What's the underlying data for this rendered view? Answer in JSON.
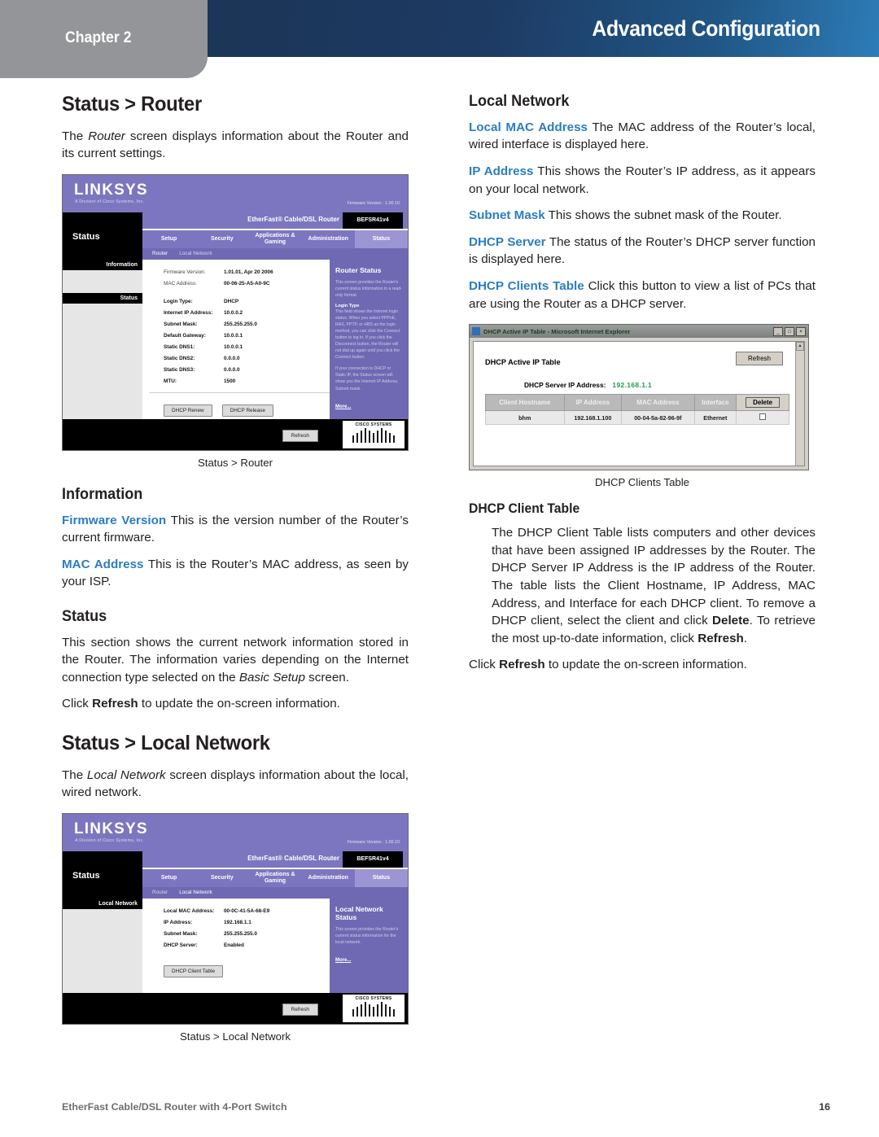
{
  "header": {
    "chapter": "Chapter 2",
    "title": "Advanced Configuration",
    "band_color": "#1c3557",
    "tab_color": "#939598"
  },
  "left_column": {
    "heading_status_router": "Status > Router",
    "intro_1": "The ",
    "intro_italic": "Router",
    "intro_2": " screen displays information about the Router and its current settings.",
    "caption_router": "Status > Router",
    "heading_information": "Information",
    "firmware_term": "Firmware Version",
    "firmware_text": " This is the version number of the Router’s current firmware.",
    "mac_term": "MAC Address",
    "mac_text": " This is the Router’s MAC address, as seen by your ISP.",
    "heading_status": "Status",
    "status_text_1": "This section shows the current network information stored in the Router. The information varies depending on the Internet connection type selected on the ",
    "status_italic": "Basic Setup",
    "status_text_2": " screen.",
    "refresh_pre": "Click ",
    "refresh_bold": "Refresh",
    "refresh_post": " to update the on-screen information.",
    "heading_status_local": "Status > Local Network",
    "local_intro_1": "The ",
    "local_intro_italic": "Local Network",
    "local_intro_2": " screen displays information about the local, wired network.",
    "caption_local": "Status > Local Network"
  },
  "right_column": {
    "heading_local_network": "Local Network",
    "local_mac_term": "Local MAC Address",
    "local_mac_text": " The MAC address of the Router’s local, wired interface is displayed here.",
    "ip_term": "IP Address",
    "ip_text": " This shows the Router’s IP address, as it appears on your local network.",
    "subnet_term": "Subnet Mask",
    "subnet_text": "  This shows the subnet mask of the Router.",
    "dhcp_server_term": "DHCP Server",
    "dhcp_server_text": " The status of the Router’s DHCP server function is displayed here.",
    "dhcp_clients_term": "DHCP Clients Table",
    "dhcp_clients_text": "  Click this button to view a list of PCs that are using the Router as a DHCP server.",
    "caption_dhcp": "DHCP Clients Table",
    "heading_dhcp_client_table": "DHCP Client Table",
    "dhcp_body_1": "The DHCP Client Table lists computers and other devices that have been assigned IP addresses by the Router. The DHCP Server IP Address is the IP address of the Router. The table lists the Client Hostname, IP Address, MAC Address, and Interface for each DHCP client. To remove a DHCP client, select the client and click ",
    "dhcp_body_delete": "Delete",
    "dhcp_body_2": ". To retrieve the most up-to-date information, click ",
    "dhcp_body_refresh": "Refresh",
    "dhcp_body_3": ".",
    "refresh_pre": "Click ",
    "refresh_bold": "Refresh",
    "refresh_post": " to update the on-screen information."
  },
  "router_screenshot": {
    "brand": "LINKSYS",
    "brand_sub": "A Division of Cisco Systems, Inc.",
    "firmware_version_label": "Firmware Version : 1.00.10",
    "section_word": "Status",
    "product_name": "EtherFast® Cable/DSL Router",
    "model": "BEFSR41v4",
    "tabs": [
      "Setup",
      "Security",
      "Applications & Gaming",
      "Administration",
      "Status"
    ],
    "active_tab": "Status",
    "subtabs": [
      "Router",
      "Local Network"
    ],
    "active_subtab": "Router",
    "sidebar_headings": [
      "Information",
      "Status"
    ],
    "fields": [
      {
        "label": "Firmware Version:",
        "value": "1.01.01, Apr 20 2006",
        "bold": false
      },
      {
        "label": "MAC Address:",
        "value": "00-06-25-A5-A0-9C",
        "bold": false
      },
      {
        "label": "Login Type:",
        "value": "DHCP",
        "bold": true
      },
      {
        "label": "Internet IP Address:",
        "value": "10.0.0.2",
        "bold": true
      },
      {
        "label": "Subnet Mask:",
        "value": "255.255.255.0",
        "bold": true
      },
      {
        "label": "Default Gateway:",
        "value": "10.0.0.1",
        "bold": true
      },
      {
        "label": "Static DNS1:",
        "value": "10.0.0.1",
        "bold": true
      },
      {
        "label": "Static DNS2:",
        "value": "0.0.0.0",
        "bold": true
      },
      {
        "label": "Static DNS3:",
        "value": "0.0.0.0",
        "bold": true
      },
      {
        "label": "MTU:",
        "value": "1500",
        "bold": true
      }
    ],
    "buttons": [
      "DHCP Renew",
      "DHCP Release"
    ],
    "refresh_button": "Refresh",
    "help_title": "Router Status",
    "help_p1": "This screen provides the Router's current status information in a read-only format.",
    "help_h2": "Login Type",
    "help_p2": "This field shows the Internet login status. When you select PPPoE, RAS, PPTP, or HBS as the login method, you can click the Connect button to log in. If you click the Disconnect button, the Router will not dial up again until you click the Connect button.",
    "help_p3": "If your connection is DHCP or Static IP, the Status screen will show you the Internet IP Address, Subnet mask.",
    "help_more": "More...",
    "cisco_name": "CISCO SYSTEMS"
  },
  "lan_screenshot": {
    "brand": "LINKSYS",
    "brand_sub": "A Division of Cisco Systems, Inc.",
    "firmware_version_label": "Firmware Version : 1.00.10",
    "section_word": "Status",
    "product_name": "EtherFast® Cable/DSL Router",
    "model": "BEFSR41v4",
    "tabs": [
      "Setup",
      "Security",
      "Applications & Gaming",
      "Administration",
      "Status"
    ],
    "active_tab": "Status",
    "subtabs": [
      "Router",
      "Local Network"
    ],
    "active_subtab": "Local Network",
    "sidebar_headings": [
      "Local Network"
    ],
    "fields": [
      {
        "label": "Local MAC Address:",
        "value": "00-0C-41-5A-68-E9",
        "bold": true
      },
      {
        "label": "IP Address:",
        "value": "192.168.1.1",
        "bold": true
      },
      {
        "label": "Subnet Mask:",
        "value": "255.255.255.0",
        "bold": true
      },
      {
        "label": "DHCP Server:",
        "value": "Enabled",
        "bold": true
      }
    ],
    "buttons": [
      "DHCP Client Table"
    ],
    "refresh_button": "Refresh",
    "help_title": "Local Network Status",
    "help_p1": "This screen provides the Router's current status information for the local network.",
    "help_more": "More...",
    "cisco_name": "CISCO SYSTEMS"
  },
  "dhcp_window": {
    "title": "DHCP Active IP Table - Microsoft Internet Explorer",
    "minimize": "_",
    "maximize": "□",
    "close": "×",
    "heading": "DHCP Active IP Table",
    "refresh_button": "Refresh",
    "server_ip_label": "DHCP Server IP Address:",
    "server_ip_value": "192.168.1.1",
    "columns": [
      "Client Hostname",
      "IP Address",
      "MAC Address",
      "Interface"
    ],
    "delete_button": "Delete",
    "rows": [
      {
        "hostname": "bhm",
        "ip": "192.168.1.100",
        "mac": "00-04-5a-82-96-9f",
        "interface": "Ethernet"
      }
    ]
  },
  "footer": {
    "text": "EtherFast Cable/DSL Router with 4-Port Switch",
    "page_number": "16"
  }
}
